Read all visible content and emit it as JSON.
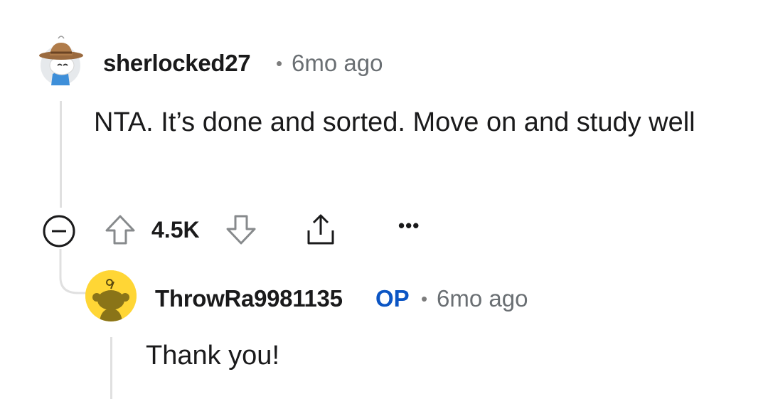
{
  "comments": [
    {
      "username": "sherlocked27",
      "dot": "•",
      "time": "6mo ago",
      "body": "NTA. It’s done and sorted. Move on and study well",
      "score": "4.5K",
      "avatar_icon": "cowboy-snoo-avatar-icon"
    },
    {
      "username": "ThrowRa9981135",
      "badge": "OP",
      "dot": "•",
      "time": "6mo ago",
      "body": "Thank you!",
      "avatar_icon": "default-snoo-avatar-icon"
    }
  ],
  "actions": {
    "collapse_icon": "collapse-minus-icon",
    "upvote_icon": "upvote-arrow-icon",
    "downvote_icon": "downvote-arrow-icon",
    "share_icon": "share-icon",
    "more_label": "•••"
  },
  "colors": {
    "op_badge": "#0b55c4",
    "avatar_yellow": "#ffd635",
    "meta_gray": "#6a6f73"
  }
}
